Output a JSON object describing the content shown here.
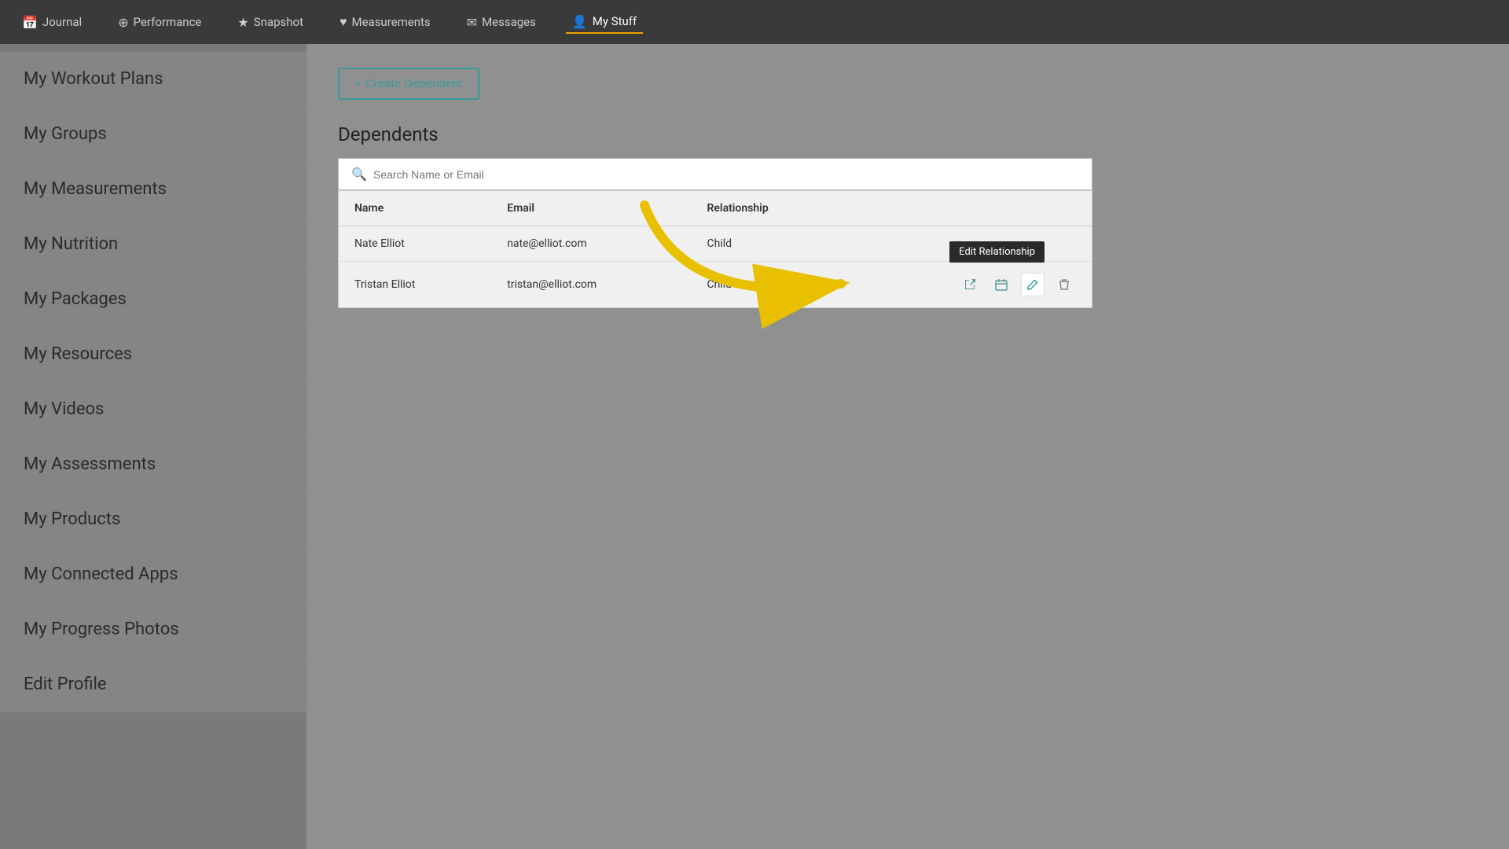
{
  "nav": {
    "items": [
      {
        "id": "journal",
        "label": "Journal",
        "icon": "📅",
        "active": false
      },
      {
        "id": "performance",
        "label": "Performance",
        "icon": "➕",
        "active": false
      },
      {
        "id": "snapshot",
        "label": "Snapshot",
        "icon": "⭐",
        "active": false
      },
      {
        "id": "measurements",
        "label": "Measurements",
        "icon": "♥",
        "active": false
      },
      {
        "id": "messages",
        "label": "Messages",
        "icon": "✉",
        "active": false
      },
      {
        "id": "mystuff",
        "label": "My Stuff",
        "icon": "👤",
        "active": true
      }
    ]
  },
  "sidebar": {
    "items": [
      {
        "id": "workout-plans",
        "label": "My Workout Plans"
      },
      {
        "id": "groups",
        "label": "My Groups"
      },
      {
        "id": "measurements",
        "label": "My Measurements"
      },
      {
        "id": "nutrition",
        "label": "My Nutrition"
      },
      {
        "id": "packages",
        "label": "My Packages"
      },
      {
        "id": "resources",
        "label": "My Resources"
      },
      {
        "id": "videos",
        "label": "My Videos"
      },
      {
        "id": "assessments",
        "label": "My Assessments"
      },
      {
        "id": "products",
        "label": "My Products"
      },
      {
        "id": "connected-apps",
        "label": "My Connected Apps"
      },
      {
        "id": "progress-photos",
        "label": "My Progress Photos"
      },
      {
        "id": "edit-profile",
        "label": "Edit Profile"
      }
    ]
  },
  "main": {
    "create_button_label": "+ Create Dependent",
    "section_title": "Dependents",
    "search_placeholder": "Search Name or Email",
    "table": {
      "columns": [
        "Name",
        "Email",
        "Relationship"
      ],
      "rows": [
        {
          "name": "Nate Elliot",
          "email": "nate@elliot.com",
          "relationship": "Child",
          "show_icons": false
        },
        {
          "name": "Tristan Elliot",
          "email": "tristan@elliot.com",
          "relationship": "Child",
          "show_icons": true
        }
      ]
    },
    "tooltip": {
      "edit_label": "Edit Relationship"
    }
  },
  "colors": {
    "teal": "#3a9a9a",
    "dark_bg": "#3a3a3a",
    "sidebar_bg": "#858585",
    "main_bg": "#909090",
    "arrow_color": "#e8c000"
  }
}
